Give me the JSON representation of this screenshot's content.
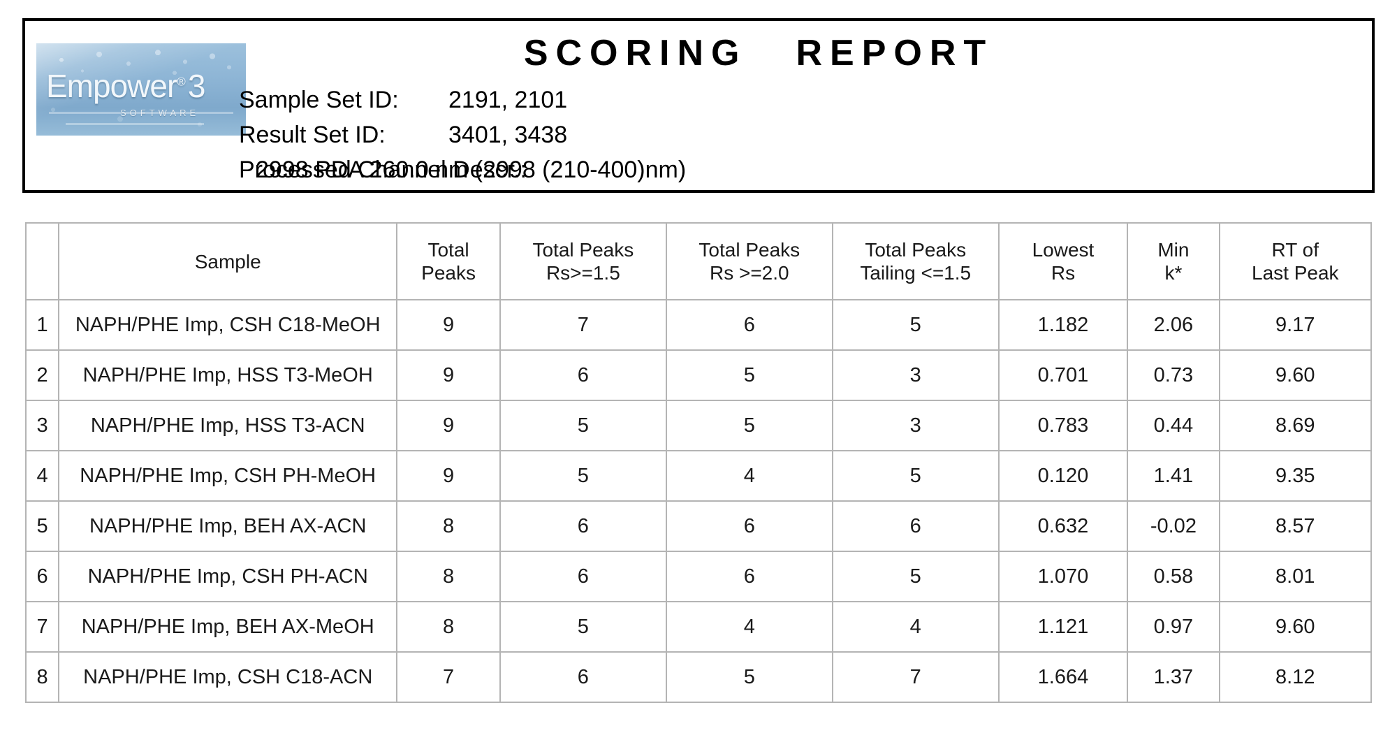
{
  "header": {
    "title_part1": "SCORING",
    "title_part2": "REPORT",
    "logo": {
      "word": "Empower",
      "registered": "®",
      "version": "3",
      "subtitle": "SOFTWARE"
    },
    "fields": [
      {
        "label": "Sample Set ID:",
        "value": "2191, 2101"
      },
      {
        "label": "Result Set ID:",
        "value": "3401, 3438"
      },
      {
        "label": "Processed Channel Descr.:",
        "value": "2998 PDA 260.0 nm (2998 (210-400)nm)"
      }
    ]
  },
  "table": {
    "columns": [
      {
        "line1": "",
        "line2": ""
      },
      {
        "line1": "Sample",
        "line2": ""
      },
      {
        "line1": "Total",
        "line2": "Peaks"
      },
      {
        "line1": "Total Peaks",
        "line2": "Rs>=1.5"
      },
      {
        "line1": "Total Peaks",
        "line2": "Rs >=2.0"
      },
      {
        "line1": "Total Peaks",
        "line2": "Tailing <=1.5"
      },
      {
        "line1": "Lowest",
        "line2": "Rs"
      },
      {
        "line1": "Min",
        "line2": "k*"
      },
      {
        "line1": "RT of",
        "line2": "Last Peak"
      }
    ],
    "rows": [
      {
        "idx": "1",
        "sample": "NAPH/PHE Imp, CSH C18-MeOH",
        "total_peaks": "9",
        "rs15": "7",
        "rs20": "6",
        "tailing": "5",
        "lowest_rs": "1.182",
        "min_k": "2.06",
        "rt_last": "9.17"
      },
      {
        "idx": "2",
        "sample": "NAPH/PHE Imp, HSS T3-MeOH",
        "total_peaks": "9",
        "rs15": "6",
        "rs20": "5",
        "tailing": "3",
        "lowest_rs": "0.701",
        "min_k": "0.73",
        "rt_last": "9.60"
      },
      {
        "idx": "3",
        "sample": "NAPH/PHE Imp,  HSS T3-ACN",
        "total_peaks": "9",
        "rs15": "5",
        "rs20": "5",
        "tailing": "3",
        "lowest_rs": "0.783",
        "min_k": "0.44",
        "rt_last": "8.69"
      },
      {
        "idx": "4",
        "sample": "NAPH/PHE Imp, CSH PH-MeOH",
        "total_peaks": "9",
        "rs15": "5",
        "rs20": "4",
        "tailing": "5",
        "lowest_rs": "0.120",
        "min_k": "1.41",
        "rt_last": "9.35"
      },
      {
        "idx": "5",
        "sample": "NAPH/PHE Imp,  BEH AX-ACN",
        "total_peaks": "8",
        "rs15": "6",
        "rs20": "6",
        "tailing": "6",
        "lowest_rs": "0.632",
        "min_k": "-0.02",
        "rt_last": "8.57"
      },
      {
        "idx": "6",
        "sample": "NAPH/PHE Imp, CSH PH-ACN",
        "total_peaks": "8",
        "rs15": "6",
        "rs20": "6",
        "tailing": "5",
        "lowest_rs": "1.070",
        "min_k": "0.58",
        "rt_last": "8.01"
      },
      {
        "idx": "7",
        "sample": "NAPH/PHE Imp, BEH AX-MeOH",
        "total_peaks": "8",
        "rs15": "5",
        "rs20": "4",
        "tailing": "4",
        "lowest_rs": "1.121",
        "min_k": "0.97",
        "rt_last": "9.60"
      },
      {
        "idx": "8",
        "sample": "NAPH/PHE Imp, CSH C18-ACN",
        "total_peaks": "7",
        "rs15": "6",
        "rs20": "5",
        "tailing": "7",
        "lowest_rs": "1.664",
        "min_k": "1.37",
        "rt_last": "8.12"
      }
    ]
  },
  "colors": {
    "border_dark": "#000000",
    "border_grid": "#b4b4b4",
    "logo_blue": "#8fb6d6",
    "text": "#1a1a1a"
  }
}
